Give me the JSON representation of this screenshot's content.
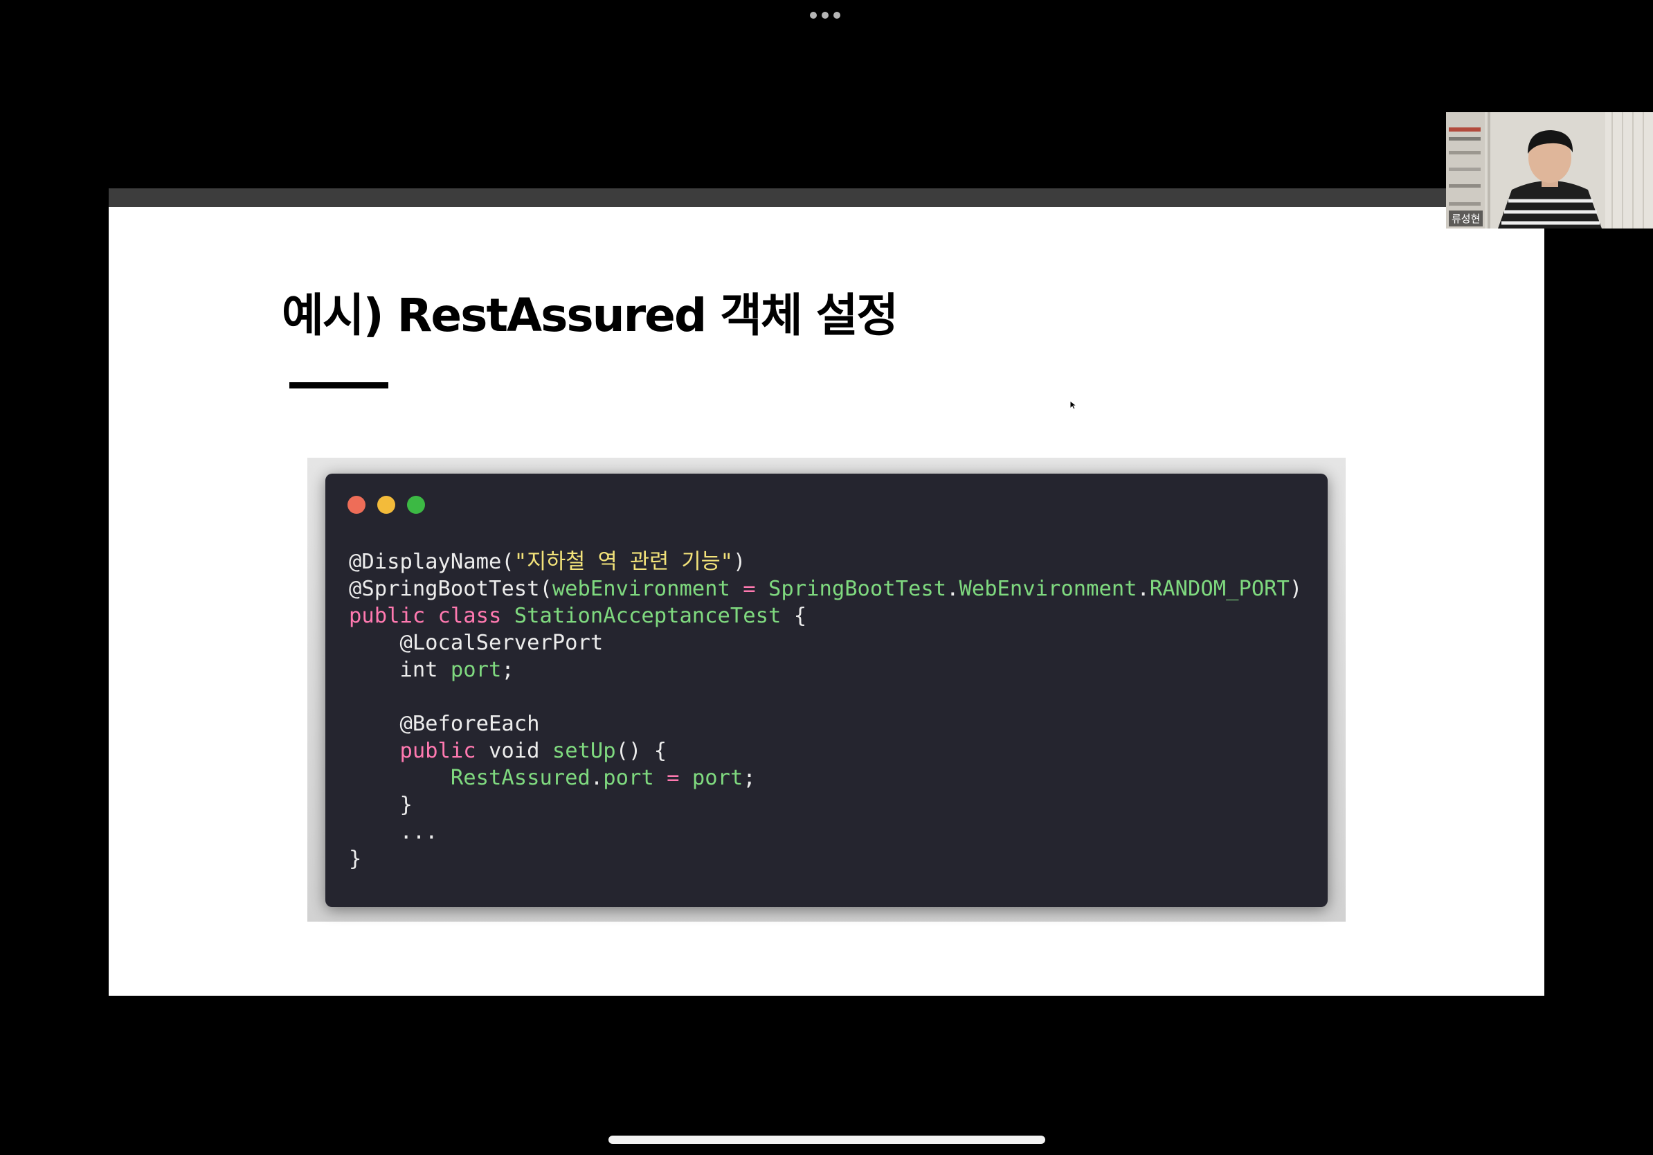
{
  "slide": {
    "title": "예시) RestAssured 객체 설정"
  },
  "code_window": {
    "lines": [
      [
        [
          "plain",
          "@DisplayName("
        ],
        [
          "str",
          "\"지하철 역 관련 기능\""
        ],
        [
          "plain",
          ")"
        ]
      ],
      [
        [
          "plain",
          "@SpringBootTest("
        ],
        [
          "fn",
          "webEnvironment"
        ],
        [
          "plain",
          " "
        ],
        [
          "kw",
          "="
        ],
        [
          "plain",
          " "
        ],
        [
          "fn",
          "SpringBootTest"
        ],
        [
          "plain",
          "."
        ],
        [
          "fn",
          "WebEnvironment"
        ],
        [
          "plain",
          "."
        ],
        [
          "fn",
          "RANDOM_PORT"
        ],
        [
          "plain",
          ")"
        ]
      ],
      [
        [
          "kw",
          "public class"
        ],
        [
          "plain",
          " "
        ],
        [
          "fn",
          "StationAcceptanceTest"
        ],
        [
          "plain",
          " {"
        ]
      ],
      [
        [
          "plain",
          "    @LocalServerPort"
        ]
      ],
      [
        [
          "plain",
          "    int "
        ],
        [
          "fn",
          "port"
        ],
        [
          "plain",
          ";"
        ]
      ],
      [
        [
          "plain",
          ""
        ]
      ],
      [
        [
          "plain",
          "    @BeforeEach"
        ]
      ],
      [
        [
          "plain",
          "    "
        ],
        [
          "kw",
          "public"
        ],
        [
          "plain",
          " void "
        ],
        [
          "fn",
          "setUp"
        ],
        [
          "plain",
          "() {"
        ]
      ],
      [
        [
          "plain",
          "        "
        ],
        [
          "fn",
          "RestAssured"
        ],
        [
          "plain",
          "."
        ],
        [
          "fn",
          "port"
        ],
        [
          "plain",
          " "
        ],
        [
          "kw",
          "="
        ],
        [
          "plain",
          " "
        ],
        [
          "fn",
          "port"
        ],
        [
          "plain",
          ";"
        ]
      ],
      [
        [
          "plain",
          "    }"
        ]
      ],
      [
        [
          "plain",
          "    ..."
        ]
      ],
      [
        [
          "plain",
          "}"
        ]
      ]
    ]
  },
  "participant": {
    "name": "류성현"
  },
  "icons": {
    "more": "more-dots-icon",
    "cursor": "mouse-cursor-icon",
    "home": "home-indicator"
  }
}
